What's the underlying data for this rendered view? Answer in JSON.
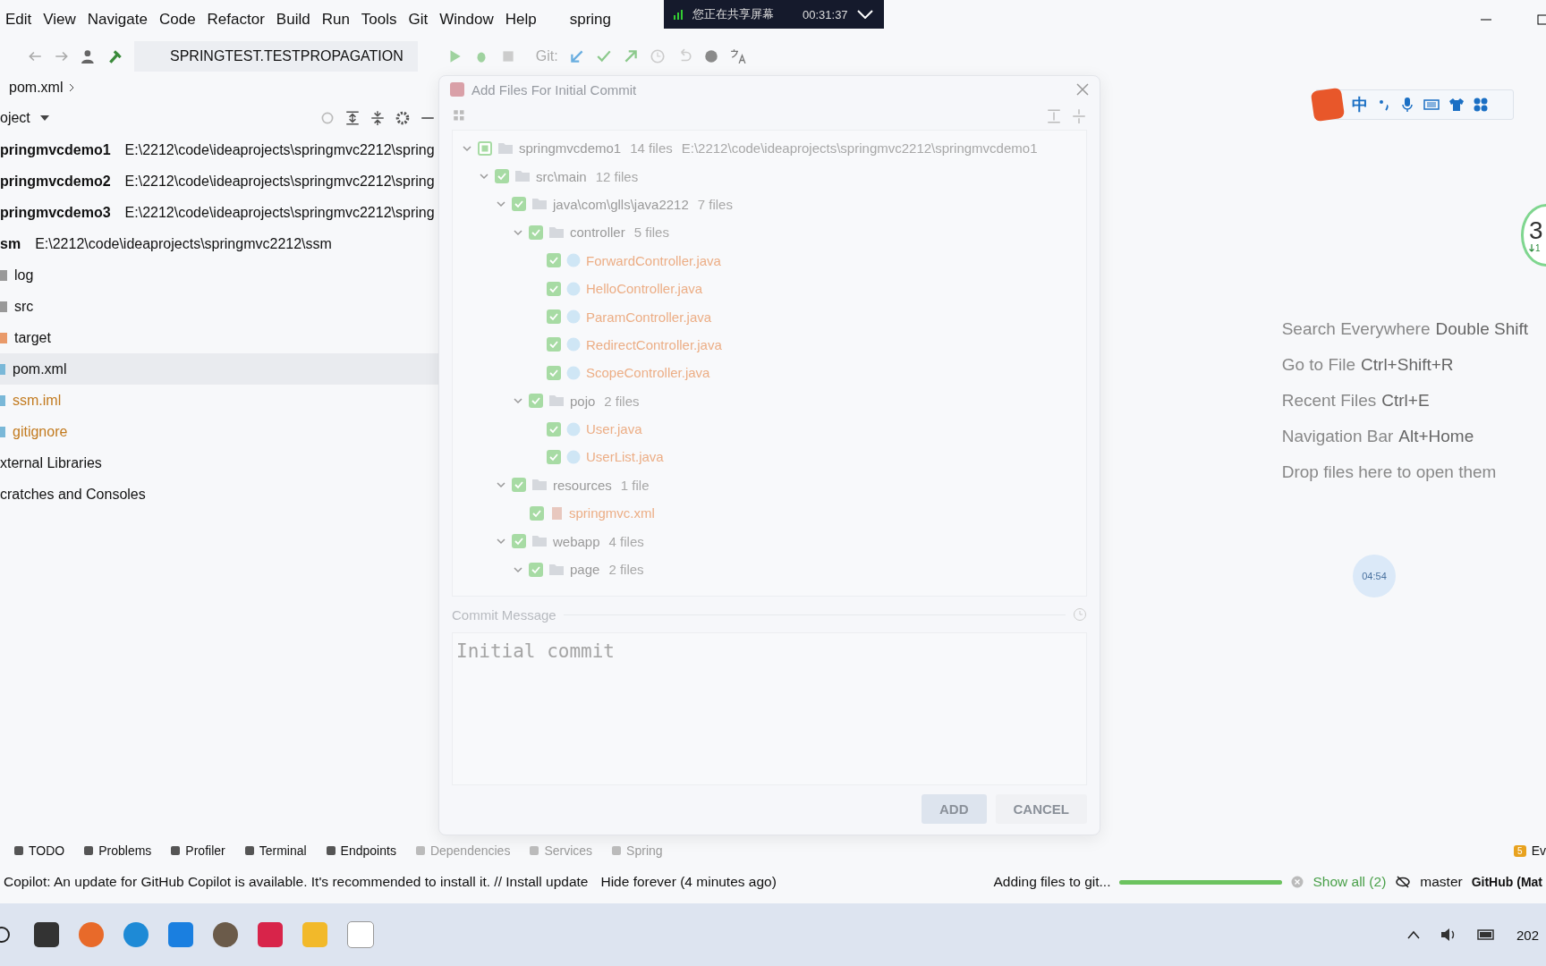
{
  "menu_bar": {
    "items": [
      "Edit",
      "View",
      "Navigate",
      "Code",
      "Refactor",
      "Build",
      "Run",
      "Tools",
      "Git",
      "Window",
      "Help"
    ],
    "title": "spring"
  },
  "share_banner": {
    "text": "您正在共享屏幕",
    "time": "00:31:37"
  },
  "toolbar": {
    "run_config": "SPRINGTEST.TESTPROPAGATION",
    "git_label": "Git:"
  },
  "breadcrumb": "pom.xml",
  "project_panel": {
    "title": "oject",
    "items": [
      {
        "kind": "module",
        "name": "pringmvcdemo1",
        "path": "E:\\2212\\code\\ideaprojects\\springmvc2212\\spring",
        "selected": false,
        "untracked": false
      },
      {
        "kind": "module",
        "name": "pringmvcdemo2",
        "path": "E:\\2212\\code\\ideaprojects\\springmvc2212\\spring",
        "selected": false,
        "untracked": false
      },
      {
        "kind": "module",
        "name": "pringmvcdemo3",
        "path": "E:\\2212\\code\\ideaprojects\\springmvc2212\\spring",
        "selected": false,
        "untracked": false
      },
      {
        "kind": "module",
        "name": "sm",
        "path": "E:\\2212\\code\\ideaprojects\\springmvc2212\\ssm",
        "selected": false,
        "untracked": false
      },
      {
        "kind": "folder",
        "name": "log",
        "selected": false,
        "untracked": false
      },
      {
        "kind": "folder",
        "name": "src",
        "selected": false,
        "untracked": false
      },
      {
        "kind": "excluded",
        "name": "target",
        "selected": false,
        "untracked": false
      },
      {
        "kind": "file",
        "name": "pom.xml",
        "selected": true,
        "untracked": false
      },
      {
        "kind": "file",
        "name": "ssm.iml",
        "selected": false,
        "untracked": true
      },
      {
        "kind": "file",
        "name": "gitignore",
        "selected": false,
        "untracked": true
      },
      {
        "kind": "library",
        "name": "xternal Libraries",
        "selected": false,
        "untracked": false
      },
      {
        "kind": "scratch",
        "name": "cratches and Consoles",
        "selected": false,
        "untracked": false
      }
    ]
  },
  "dialog": {
    "title": "Add Files For Initial Commit",
    "tree": [
      {
        "kind": "module",
        "name": "springmvcdemo1",
        "count": "14 files",
        "path": "E:\\2212\\code\\ideaprojects\\springmvc2212\\springmvcdemo1",
        "checked": true,
        "partial": true,
        "expanded": true,
        "children": [
          {
            "kind": "folder",
            "name": "src\\main",
            "count": "12 files",
            "checked": true,
            "partial": false,
            "expanded": true,
            "children": [
              {
                "kind": "folder",
                "name": "java\\com\\glls\\java2212",
                "count": "7 files",
                "checked": true,
                "partial": false,
                "expanded": true,
                "children": [
                  {
                    "kind": "folder",
                    "name": "controller",
                    "count": "5 files",
                    "checked": true,
                    "partial": false,
                    "expanded": true,
                    "children": [
                      {
                        "kind": "class",
                        "name": "ForwardController.java",
                        "checked": true,
                        "partial": false
                      },
                      {
                        "kind": "class",
                        "name": "HelloController.java",
                        "checked": true,
                        "partial": false
                      },
                      {
                        "kind": "class",
                        "name": "ParamController.java",
                        "checked": true,
                        "partial": false
                      },
                      {
                        "kind": "class",
                        "name": "RedirectController.java",
                        "checked": true,
                        "partial": false
                      },
                      {
                        "kind": "class",
                        "name": "ScopeController.java",
                        "checked": true,
                        "partial": false
                      }
                    ]
                  },
                  {
                    "kind": "folder",
                    "name": "pojo",
                    "count": "2 files",
                    "checked": true,
                    "partial": false,
                    "expanded": true,
                    "children": [
                      {
                        "kind": "class",
                        "name": "User.java",
                        "checked": true,
                        "partial": false
                      },
                      {
                        "kind": "class",
                        "name": "UserList.java",
                        "checked": true,
                        "partial": false
                      }
                    ]
                  }
                ]
              },
              {
                "kind": "folder",
                "name": "resources",
                "count": "1 file",
                "checked": true,
                "partial": false,
                "expanded": true,
                "children": [
                  {
                    "kind": "xml",
                    "name": "springmvc.xml",
                    "checked": true,
                    "partial": false
                  }
                ]
              },
              {
                "kind": "folder",
                "name": "webapp",
                "count": "4 files",
                "checked": true,
                "partial": false,
                "expanded": true,
                "children": [
                  {
                    "kind": "folder",
                    "name": "page",
                    "count": "2 files",
                    "checked": true,
                    "partial": false,
                    "expanded": true
                  }
                ]
              }
            ]
          }
        ]
      }
    ],
    "commit_label": "Commit Message",
    "commit_message": "Initial commit",
    "buttons": [
      {
        "label": "ADD",
        "primary": true
      },
      {
        "label": "CANCEL",
        "primary": false
      }
    ]
  },
  "editor_hints": [
    {
      "action": "Search Everywhere",
      "shortcut": "Double Shift"
    },
    {
      "action": "Go to File",
      "shortcut": "Ctrl+Shift+R"
    },
    {
      "action": "Recent Files",
      "shortcut": "Ctrl+E"
    },
    {
      "action": "Navigation Bar",
      "shortcut": "Alt+Home"
    },
    {
      "action": "Drop files here to open them"
    }
  ],
  "ime_bar": {
    "mode": "中"
  },
  "timer_bubble": "04:54",
  "score_circle": {
    "value": "3",
    "sub": "1"
  },
  "tool_tabs": [
    "TODO",
    "Problems",
    "Profiler",
    "Terminal",
    "Endpoints",
    "Dependencies",
    "Services",
    "Spring"
  ],
  "event_log": {
    "badge": "5",
    "label": "Ev"
  },
  "status_bar": {
    "message": "Copilot: An update for GitHub Copilot is available. It's recommended to install it. // Install update",
    "hide": "Hide forever (4 minutes ago)",
    "task": "Adding files to git...",
    "level": 1.0,
    "show_all": "Show all (2)",
    "branch": "master",
    "account": "GitHub (Mat"
  },
  "taskbar": {
    "clock": "202"
  }
}
